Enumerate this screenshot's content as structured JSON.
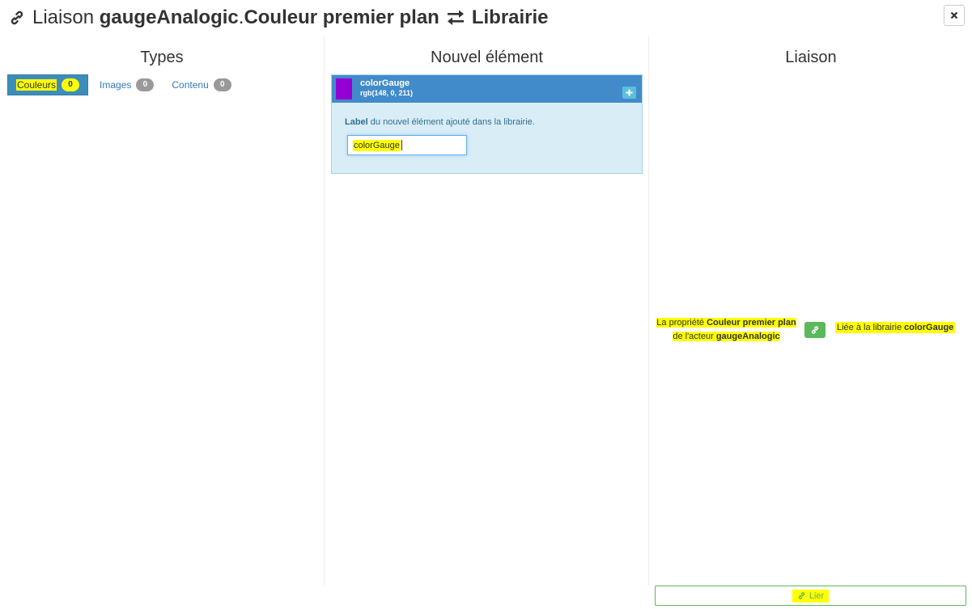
{
  "header": {
    "title_prefix": "Liaison",
    "actor": "gaugeAnalogic",
    "separator": ".",
    "property": "Couleur premier plan",
    "target": "Librairie",
    "icon_link": "link-icon",
    "icon_exchange": "exchange-icon",
    "close_icon": "close-icon"
  },
  "types": {
    "title": "Types",
    "tabs": [
      {
        "label": "Couleurs",
        "count": "0",
        "active": true
      },
      {
        "label": "Images",
        "count": "0",
        "active": false
      },
      {
        "label": "Contenu",
        "count": "0",
        "active": false
      }
    ]
  },
  "new_element": {
    "title": "Nouvel élément",
    "item_name": "colorGauge",
    "item_rgb": "rgb(148, 0, 211)",
    "swatch_color": "#9400d3",
    "add_icon": "plus-icon",
    "label_bold": "Label",
    "label_rest": " du nouvel élément ajouté dans la librairie.",
    "input_value": "colorGauge"
  },
  "link": {
    "title": "Liaison",
    "prop_prefix": "La propriété ",
    "prop_name": "Couleur premier plan",
    "prop_middle": " de l'acteur ",
    "prop_actor": "gaugeAnalogic",
    "lib_prefix": "Liée à la librairie ",
    "lib_name": "colorGauge",
    "lier_label": "Lier"
  },
  "colors": {
    "active_tab": "#3c8dbc",
    "card_head": "#428bca",
    "card_body": "#d9edf7",
    "success": "#5cb85c",
    "highlight": "#ffff00",
    "link_text": "#337ab7"
  }
}
